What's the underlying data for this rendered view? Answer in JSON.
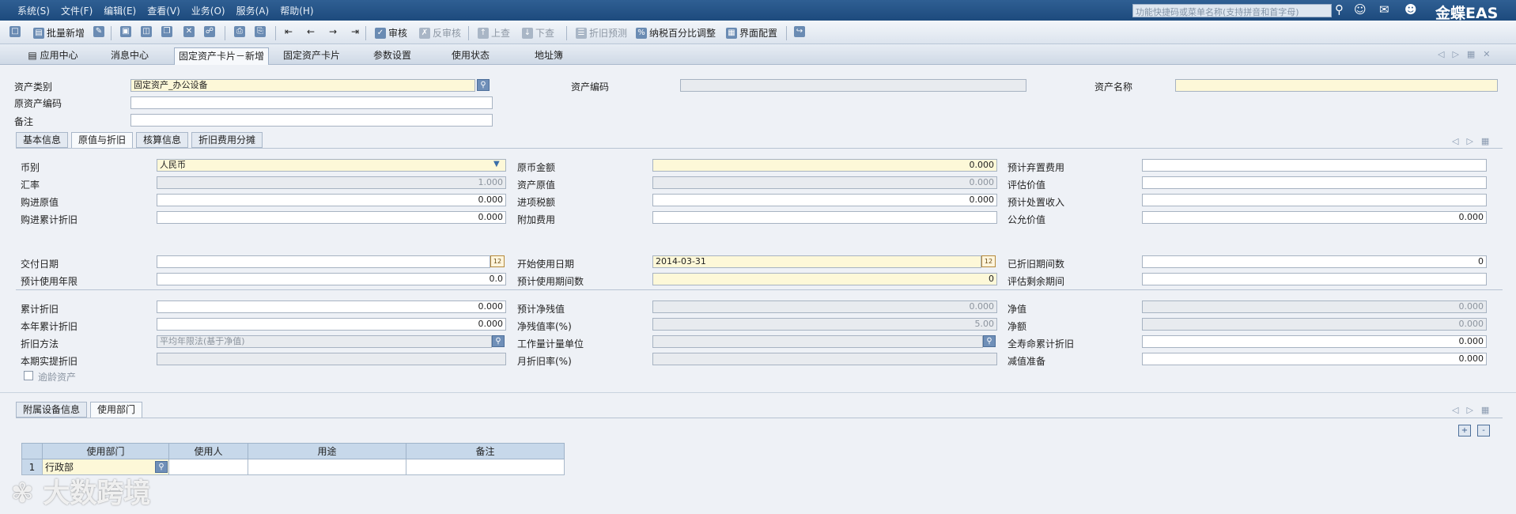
{
  "menu": [
    "系统(S)",
    "文件(F)",
    "编辑(E)",
    "查看(V)",
    "业务(O)",
    "服务(A)",
    "帮助(H)"
  ],
  "search_placeholder": "功能快捷码或菜单名称(支持拼音和首字母)",
  "brand": "金蝶EAS",
  "toolbar": {
    "batch_new": "批量新增",
    "audit": "审核",
    "unaudit": "反审核",
    "prev": "上查",
    "next": "下查",
    "depr_forecast": "折旧预测",
    "tax_adjust": "纳税百分比调整",
    "ui_config": "界面配置"
  },
  "window_tabs": [
    "应用中心",
    "消息中心",
    "固定资产卡片－新增",
    "固定资产卡片",
    "参数设置",
    "使用状态",
    "地址簿"
  ],
  "header_form": {
    "asset_category_label": "资产类别",
    "asset_category_value": "固定资产_办公设备",
    "asset_code_label": "资产编码",
    "asset_name_label": "资产名称",
    "orig_code_label": "原资产编码",
    "remark_label": "备注"
  },
  "detail_tabs": [
    "基本信息",
    "原值与折旧",
    "核算信息",
    "折旧费用分摊"
  ],
  "col1": {
    "currency": "币别",
    "currency_value": "人民币",
    "exchange_rate": "汇率",
    "exchange_rate_value": "1.000",
    "purchase_orig": "购进原值",
    "purchase_orig_value": "0.000",
    "purchase_accum": "购进累计折旧",
    "purchase_accum_value": "0.000",
    "delivery_date": "交付日期",
    "est_years": "预计使用年限",
    "est_years_value": "0.0",
    "accum_depr": "累计折旧",
    "accum_depr_value": "0.000",
    "year_accum": "本年累计折旧",
    "year_accum_value": "0.000",
    "depr_method": "折旧方法",
    "depr_method_value": "平均年限法(基于净值)",
    "current_depr": "本期实提折旧",
    "overage": "逾龄资产"
  },
  "col2": {
    "orig_amount": "原币金额",
    "orig_amount_value": "0.000",
    "asset_orig": "资产原值",
    "asset_orig_value": "0.000",
    "input_tax": "进项税额",
    "input_tax_value": "0.000",
    "extra_cost": "附加费用",
    "start_date": "开始使用日期",
    "start_date_value": "2014-03-31",
    "est_periods": "预计使用期间数",
    "est_periods_value": "0",
    "est_residual": "预计净残值",
    "est_residual_value": "0.000",
    "residual_rate": "净残值率(%)",
    "residual_rate_value": "5.00",
    "workload_unit": "工作量计量单位",
    "monthly_rate": "月折旧率(%)"
  },
  "col3": {
    "disposal_cost": "预计弃置费用",
    "eval_value": "评估价值",
    "disposal_income": "预计处置收入",
    "fair_value": "公允价值",
    "fair_value_value": "0.000",
    "depr_periods": "已折旧期间数",
    "depr_periods_value": "0",
    "eval_remaining": "评估剩余期间",
    "net_value": "净值",
    "net_value_value": "0.000",
    "net_amount": "净额",
    "net_amount_value": "0.000",
    "life_accum": "全寿命累计折旧",
    "life_accum_value": "0.000",
    "impairment": "减值准备",
    "impairment_value": "0.000"
  },
  "bottom_tabs": [
    "附属设备信息",
    "使用部门"
  ],
  "grid": {
    "headers": [
      "使用部门",
      "使用人",
      "用途",
      "备注"
    ],
    "rows": [
      [
        "1",
        "行政部",
        "",
        "",
        ""
      ]
    ]
  },
  "watermark": "大数跨境"
}
